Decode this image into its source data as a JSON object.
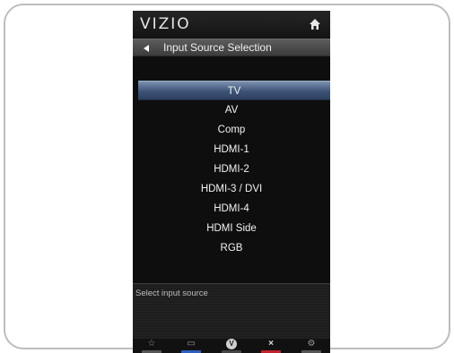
{
  "header": {
    "logo": "VIZIO",
    "home_icon": "home-icon"
  },
  "title_bar": {
    "back_icon": "back-arrow-icon",
    "title": "Input Source Selection"
  },
  "menu": {
    "selected_index": 0,
    "items": [
      {
        "label": "TV"
      },
      {
        "label": "AV"
      },
      {
        "label": "Comp"
      },
      {
        "label": "HDMI-1"
      },
      {
        "label": "HDMI-2"
      },
      {
        "label": "HDMI-3 / DVI"
      },
      {
        "label": "HDMI-4"
      },
      {
        "label": "HDMI Side"
      },
      {
        "label": "RGB"
      }
    ]
  },
  "help": {
    "text": "Select input source"
  },
  "bottom_buttons": [
    {
      "icon": "star-icon",
      "glyph": "☆",
      "color": "#555555"
    },
    {
      "icon": "menu-icon",
      "glyph": "▭",
      "color": "#2f5fbf"
    },
    {
      "icon": "v-icon",
      "glyph": "V",
      "color": "#444444"
    },
    {
      "icon": "close-icon",
      "glyph": "×",
      "color": "#c0232f"
    },
    {
      "icon": "settings-icon",
      "glyph": "⚙",
      "color": "#555555"
    }
  ]
}
